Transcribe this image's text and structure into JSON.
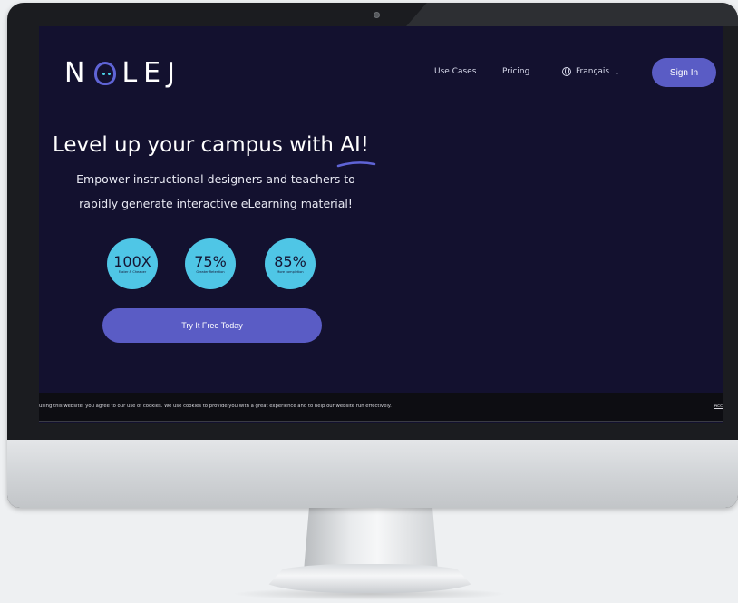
{
  "brand": {
    "logo_text_left": "N",
    "logo_text_right": "LEJ",
    "accent": "#5a5cc5",
    "stat_color": "#4fc6e6",
    "background": "#13112f"
  },
  "nav": {
    "use_cases": "Use Cases",
    "pricing": "Pricing",
    "language": "Français",
    "language_icon": "globe-icon",
    "sign_in": "Sign In"
  },
  "hero": {
    "headline_prefix": "Level up your campus with ",
    "headline_highlight": "AI!",
    "subline_1": "Empower instructional designers and teachers to",
    "subline_2": "rapidly generate interactive eLearning material!",
    "stats": [
      {
        "value": "100X",
        "label": "Faster & Cheaper"
      },
      {
        "value": "75%",
        "label": "Greater Retention"
      },
      {
        "value": "85%",
        "label": "More completion"
      }
    ],
    "cta": "Try It Free Today"
  },
  "cookie": {
    "text": "using this website, you agree to our use of cookies. We use cookies to provide you with a great experience and to help our website run effectively.",
    "accept": "Acc"
  }
}
